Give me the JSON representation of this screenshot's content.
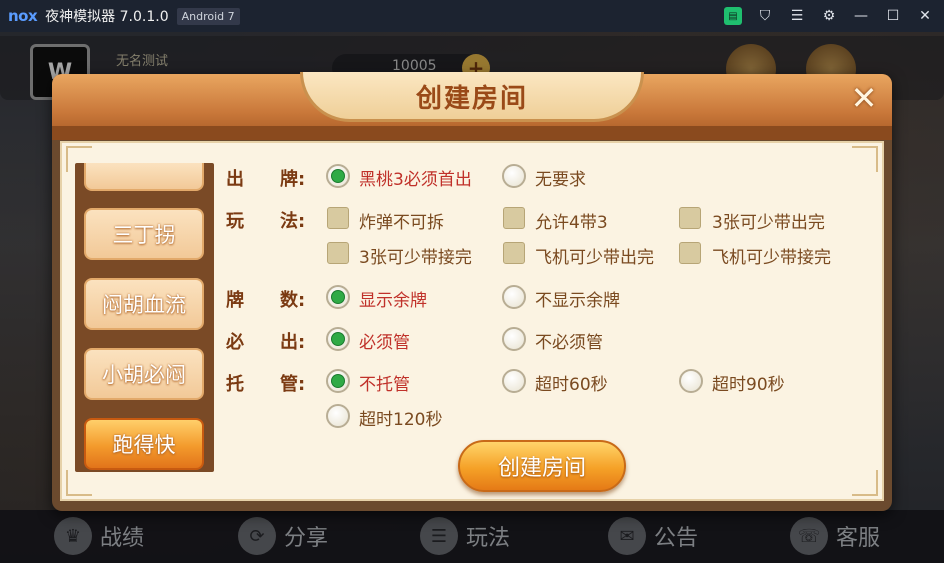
{
  "emulator": {
    "logo": "nox",
    "title": "夜神模拟器 7.0.1.0",
    "android_badge": "Android 7",
    "icons": [
      "store-icon",
      "shirt-icon",
      "menu-icon",
      "gear-icon",
      "minimize-icon",
      "maximize-icon",
      "close-icon"
    ]
  },
  "game": {
    "player_name": "无名测试",
    "avatar_text": "W",
    "coins": "10005",
    "coin_plus": "+",
    "bottom_nav": [
      {
        "label": "战绩",
        "icon": "trophy-icon"
      },
      {
        "label": "分享",
        "icon": "share-icon"
      },
      {
        "label": "玩法",
        "icon": "rules-icon"
      },
      {
        "label": "公告",
        "icon": "mail-icon"
      },
      {
        "label": "客服",
        "icon": "headset-icon"
      }
    ]
  },
  "dialog": {
    "title": "创建房间",
    "close_icon": "close-cross-icon",
    "modes": [
      {
        "label": "",
        "state": "partial"
      },
      {
        "label": "三丁拐",
        "state": "normal"
      },
      {
        "label": "闷胡血流",
        "state": "normal"
      },
      {
        "label": "小胡必闷",
        "state": "normal"
      },
      {
        "label": "跑得快",
        "state": "active"
      }
    ],
    "rows": {
      "chupai": {
        "label_1": "出",
        "label_2": "牌:",
        "options": [
          {
            "text": "黑桃3必须首出",
            "selected": true
          },
          {
            "text": "无要求",
            "selected": false
          }
        ]
      },
      "wanfa": {
        "label_1": "玩",
        "label_2": "法:",
        "options": [
          {
            "text": "炸弹不可拆",
            "checked": false
          },
          {
            "text": "允许4带3",
            "checked": false
          },
          {
            "text": "3张可少带出完",
            "checked": false
          },
          {
            "text": "3张可少带接完",
            "checked": false
          },
          {
            "text": "飞机可少带出完",
            "checked": false
          },
          {
            "text": "飞机可少带接完",
            "checked": false
          }
        ]
      },
      "paishu": {
        "label_1": "牌",
        "label_2": "数:",
        "options": [
          {
            "text": "显示余牌",
            "selected": true
          },
          {
            "text": "不显示余牌",
            "selected": false
          }
        ]
      },
      "bichu": {
        "label_1": "必",
        "label_2": "出:",
        "options": [
          {
            "text": "必须管",
            "selected": true
          },
          {
            "text": "不必须管",
            "selected": false
          }
        ]
      },
      "tuoguan": {
        "label_1": "托",
        "label_2": "管:",
        "options": [
          {
            "text": "不托管",
            "selected": true
          },
          {
            "text": "超时60秒",
            "selected": false
          },
          {
            "text": "超时90秒",
            "selected": false
          },
          {
            "text": "超时120秒",
            "selected": false
          }
        ]
      }
    },
    "create_button": "创建房间"
  },
  "colors": {
    "accent_orange": "#f39a2c",
    "label_brown": "#7b3a12",
    "selected_red": "#c0312a",
    "radio_green": "#2faa46"
  }
}
